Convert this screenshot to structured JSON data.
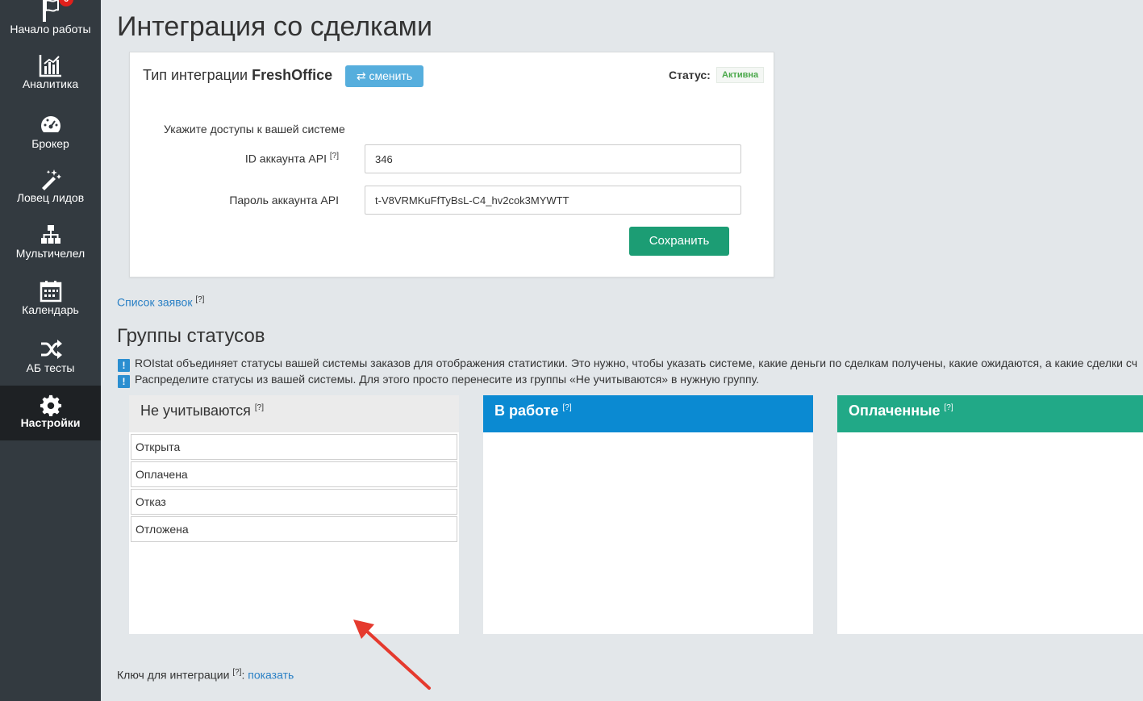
{
  "sidebar": {
    "items": [
      {
        "label": "Начало работы",
        "icon": "flag-icon",
        "badge": "6"
      },
      {
        "label": "Аналитика",
        "icon": "bar-chart-icon"
      },
      {
        "label": "Брокер",
        "icon": "dashboard-icon"
      },
      {
        "label": "Ловец лидов",
        "icon": "magic-wand-icon"
      },
      {
        "label": "Мультичелел",
        "icon": "sitemap-icon"
      },
      {
        "label": "Календарь",
        "icon": "calendar-icon"
      },
      {
        "label": "АБ тесты",
        "icon": "shuffle-icon"
      },
      {
        "label": "Настройки",
        "icon": "gear-icon",
        "active": true
      }
    ]
  },
  "page": {
    "title": "Интеграция со сделками"
  },
  "integration": {
    "type_prefix": "Тип интеграции",
    "type_name": "FreshOffice",
    "switch_label": "⇄ сменить",
    "status_label": "Статус:",
    "status_value": "Активна",
    "hint": "Укажите доступы к вашей системе",
    "api_id_label": "ID аккаунта API",
    "api_id_value": "346",
    "api_password_label": "Пароль аккаунта API",
    "api_password_value": "t-V8VRMKuFfTyBsL-C4_hv2cok3MYWTT",
    "save_label": "Сохранить",
    "help_mark": "[?]"
  },
  "orders_link": {
    "label": "Список заявок",
    "help_mark": "[?]"
  },
  "status_groups": {
    "title": "Группы статусов",
    "info_icon": "!",
    "info_lines": [
      "ROIstat объединяет статусы вашей системы заказов для отображения статистики. Это нужно, чтобы указать системе, какие деньги по сделкам получены, какие ожидаются, а какие сделки сч",
      "Распределите статусы из вашей системы. Для этого просто перенесите из группы «Не учитываются» в нужную группу."
    ],
    "columns": [
      {
        "title": "Не учитываются",
        "help_mark": "[?]",
        "items": [
          "Открыта",
          "Оплачена",
          "Отказ",
          "Отложена"
        ]
      },
      {
        "title": "В работе",
        "help_mark": "[?]",
        "items": []
      },
      {
        "title": "Оплаченные",
        "help_mark": "[?]",
        "items": []
      }
    ]
  },
  "integration_key": {
    "label": "Ключ для интеграции",
    "help_mark": "[?]",
    "separator": ":",
    "show_label": "показать"
  },
  "colors": {
    "sidebar_bg": "#333a40",
    "accent_blue": "#0b8ad2",
    "accent_green": "#21a987",
    "save_green": "#1c9d74",
    "annotation_arrow": "#e53a2e"
  }
}
